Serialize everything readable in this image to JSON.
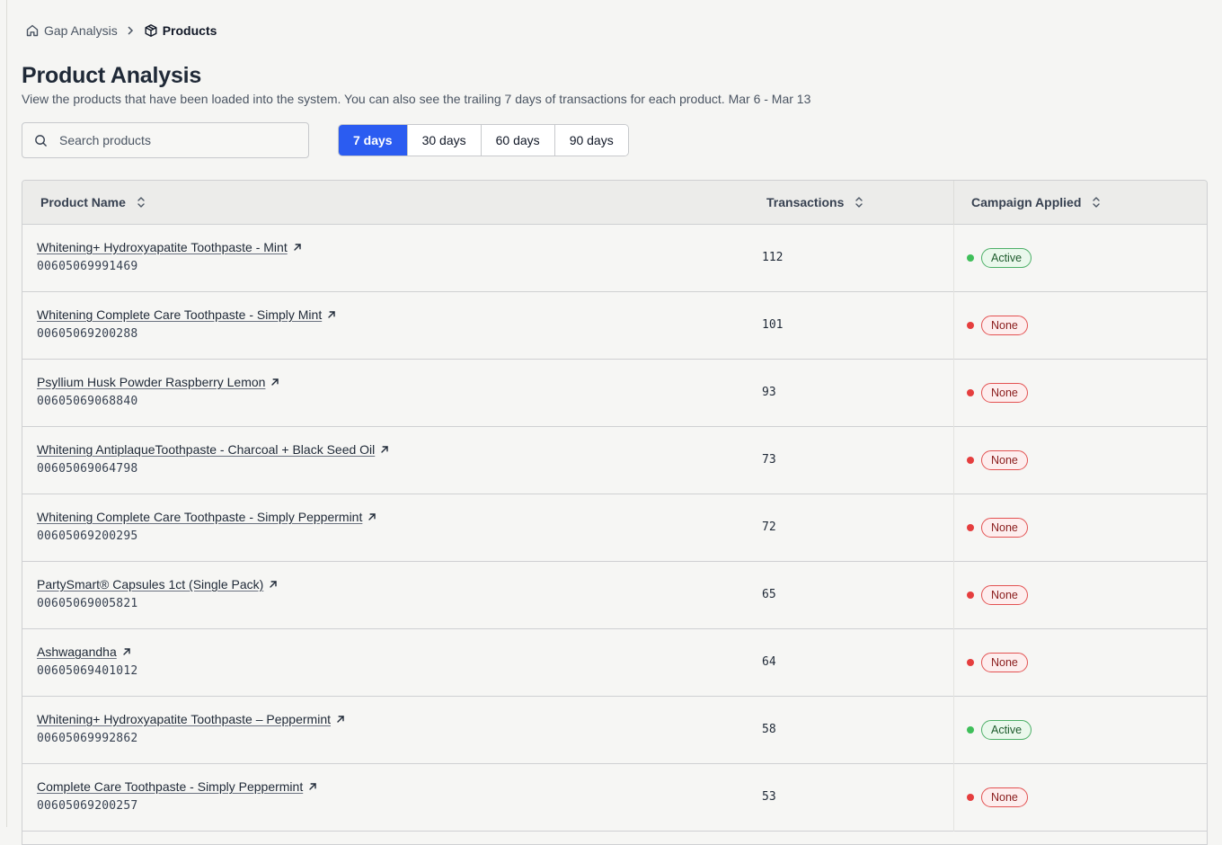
{
  "breadcrumb": {
    "home_label": "Gap Analysis",
    "current_label": "Products",
    "home_icon": "home-icon",
    "current_icon": "box-icon"
  },
  "header": {
    "title": "Product Analysis",
    "subtitle": "View the products that have been loaded into the system. You can also see the trailing 7 days of transactions for each product. Mar 6 - Mar 13"
  },
  "search": {
    "placeholder": "Search products",
    "value": ""
  },
  "range": {
    "options": [
      "7 days",
      "30 days",
      "60 days",
      "90 days"
    ],
    "selected": "7 days"
  },
  "table": {
    "columns": {
      "name": "Product Name",
      "transactions": "Transactions",
      "campaign": "Campaign Applied"
    },
    "rows": [
      {
        "name": "Whitening+ Hydroxyapatite Toothpaste - Mint",
        "sku": "00605069991469",
        "transactions": "112",
        "campaign": "Active"
      },
      {
        "name": "Whitening Complete Care Toothpaste - Simply Mint",
        "sku": "00605069200288",
        "transactions": "101",
        "campaign": "None"
      },
      {
        "name": "Psyllium Husk Powder Raspberry Lemon",
        "sku": "00605069068840",
        "transactions": "93",
        "campaign": "None"
      },
      {
        "name": "Whitening AntiplaqueToothpaste - Charcoal + Black Seed Oil",
        "sku": "00605069064798",
        "transactions": "73",
        "campaign": "None"
      },
      {
        "name": "Whitening Complete Care Toothpaste - Simply Peppermint",
        "sku": "00605069200295",
        "transactions": "72",
        "campaign": "None"
      },
      {
        "name": "PartySmart® Capsules 1ct (Single Pack)",
        "sku": "00605069005821",
        "transactions": "65",
        "campaign": "None"
      },
      {
        "name": "Ashwagandha",
        "sku": "00605069401012",
        "transactions": "64",
        "campaign": "None"
      },
      {
        "name": "Whitening+ Hydroxyapatite Toothpaste – Peppermint",
        "sku": "00605069992862",
        "transactions": "58",
        "campaign": "Active"
      },
      {
        "name": "Complete Care Toothpaste - Simply Peppermint",
        "sku": "00605069200257",
        "transactions": "53",
        "campaign": "None"
      }
    ]
  },
  "colors": {
    "accent": "#2b5cf1",
    "active_dot": "#3fbf5a",
    "none_dot": "#e53e3e"
  }
}
